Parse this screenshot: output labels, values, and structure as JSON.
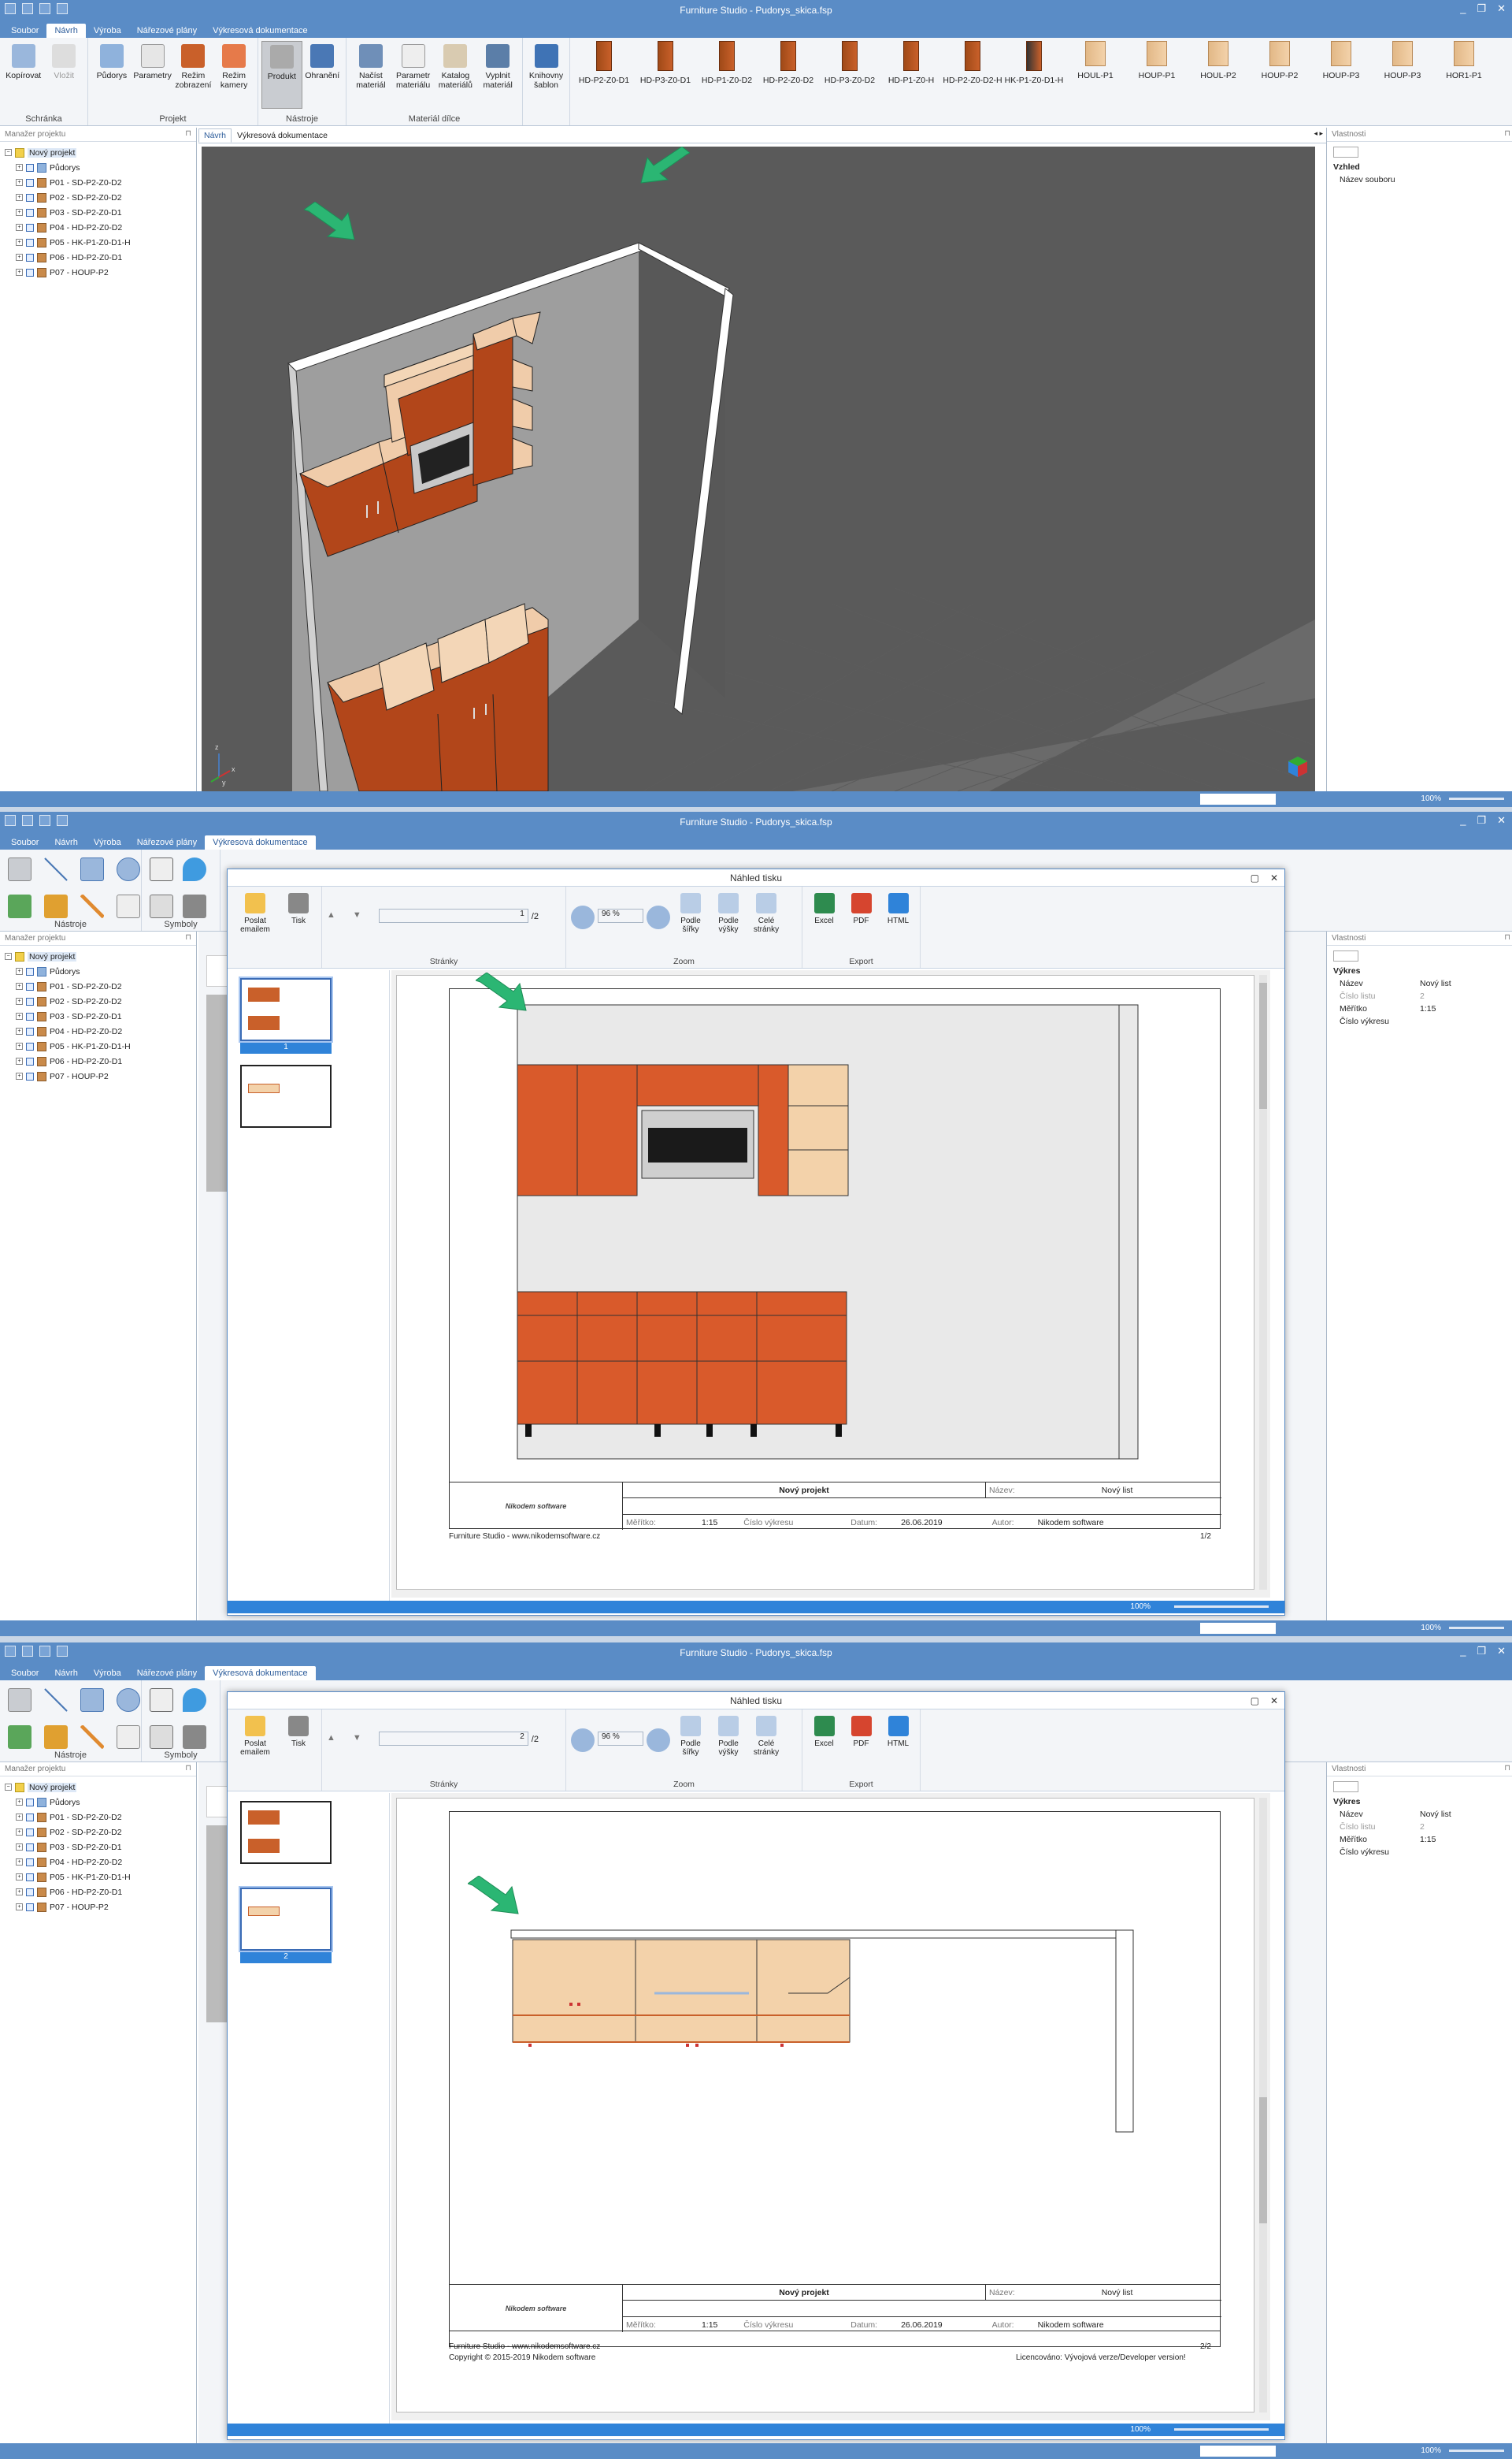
{
  "app": {
    "window_title_1": "Furniture Studio - Pudorys_skica.fsp",
    "window_title_2": "Furniture Studio - Pudorys_skica.fsp",
    "window_title_3": "Furniture Studio - Pudorys_skica.fsp"
  },
  "menu": [
    "Soubor",
    "Návrh",
    "Výroba",
    "Nářezové plány",
    "Výkresová dokumentace"
  ],
  "ribbon": {
    "groups": {
      "clipboard": "Schránka",
      "project": "Projekt",
      "tools": "Nástroje",
      "material": "Materiál dílce"
    },
    "buttons": {
      "copy": "Kopírovat",
      "paste": "Vložit",
      "floorplan": "Půdorys",
      "params": "Parametry",
      "display_mode": "Režim zobrazení",
      "camera_mode": "Režim kamery",
      "product": "Produkt",
      "edging": "Ohranění",
      "load_material": "Načíst materiál",
      "material_param": "Parametr materiálu",
      "material_catalog": "Katalog materiálů",
      "fill_material": "Vyplnit materiál",
      "template_library": "Knihovny šablon"
    },
    "products": [
      "HD-P2-Z0-D1",
      "HD-P3-Z0-D1",
      "HD-P1-Z0-D2",
      "HD-P2-Z0-D2",
      "HD-P3-Z0-D2",
      "HD-P1-Z0-H",
      "HD-P2-Z0-D2-H",
      "HK-P1-Z0-D1-H",
      "HOUL-P1",
      "HOUP-P1",
      "HOUL-P2",
      "HOUP-P2",
      "HOUP-P3",
      "HOUP-P3",
      "HOR1-P1"
    ]
  },
  "draw_tools_label": "Nástroje",
  "symbols_label": "Symboly",
  "project_manager": {
    "title": "Manažer projektu",
    "items": [
      "Nový projekt",
      "Půdorys",
      "P01 - SD-P2-Z0-D2",
      "P02 - SD-P2-Z0-D2",
      "P03 - SD-P2-Z0-D1",
      "P04 - HD-P2-Z0-D2",
      "P05 - HK-P1-Z0-D1-H",
      "P06 - HD-P2-Z0-D1",
      "P07 - HOUP-P2"
    ]
  },
  "doc_tabs": [
    "Návrh",
    "Výkresová dokumentace"
  ],
  "properties": {
    "title": "Vlastnosti",
    "screen1": {
      "section": "Vzhled",
      "k1": "Název souboru"
    },
    "screen2": {
      "section": "Výkres",
      "rows": [
        {
          "k": "Název",
          "v": "Nový list"
        },
        {
          "k": "Číslo listu",
          "v": "2"
        },
        {
          "k": "Měřítko",
          "v": "1:15"
        },
        {
          "k": "Číslo výkresu",
          "v": ""
        }
      ]
    }
  },
  "status": {
    "zoom": "100%"
  },
  "print_preview": {
    "title": "Náhled tisku",
    "buttons": {
      "email": "Poslat emailem",
      "print": "Tisk",
      "fit_width": "Podle šířky",
      "fit_height": "Podle výšky",
      "whole_page": "Celé stránky",
      "excel": "Excel",
      "pdf": "PDF",
      "html": "HTML"
    },
    "groups": {
      "pages": "Stránky",
      "zoom": "Zoom",
      "export": "Export"
    },
    "zoom_value": "96 %",
    "page_of": "/2",
    "page_1": "1",
    "page_2": "2",
    "dialog_zoom": "100%"
  },
  "titleblock": {
    "project": "Nový projekt",
    "name_label": "Název:",
    "name_value": "Nový list",
    "scale_label": "Měřítko:",
    "scale_value": "1:15",
    "drawing_no_label": "Číslo výkresu",
    "date_label": "Datum:",
    "date_value": "26.06.2019",
    "author_label": "Autor:",
    "author_value": "Nikodem software",
    "logo_text": "Nikodem software"
  },
  "footer": {
    "site": "Furniture Studio - www.nikodemsoftware.cz",
    "copyright": "Copyright © 2015-2019 Nikodem software",
    "license": "Licencováno:  Vývojová verze/Developer version!",
    "page1": "1/2",
    "page2": "2/2"
  },
  "colors": {
    "accent": "#5a8cc6",
    "cabinet": "#c9602a",
    "wood": "#f3d2aa",
    "arrow": "#2bb673"
  }
}
